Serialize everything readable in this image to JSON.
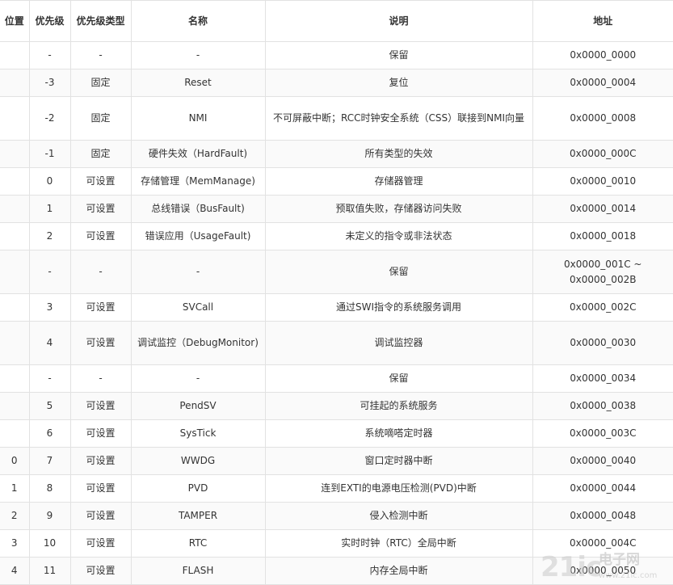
{
  "table": {
    "headers": [
      "位置",
      "优先级",
      "优先级类型",
      "名称",
      "说明",
      "地址"
    ],
    "rows": [
      {
        "pos": "",
        "priority": "-",
        "type": "-",
        "name": "-",
        "desc": "保留",
        "addr": "0x0000_0000"
      },
      {
        "pos": "",
        "priority": "-3",
        "type": "固定",
        "name": "Reset",
        "desc": "复位",
        "addr": "0x0000_0004"
      },
      {
        "pos": "",
        "priority": "-2",
        "type": "固定",
        "name": "NMI",
        "desc": "不可屏蔽中断；RCC时钟安全系统（CSS）联接到NMI向量",
        "addr": "0x0000_0008"
      },
      {
        "pos": "",
        "priority": "-1",
        "type": "固定",
        "name": "硬件失效（HardFault)",
        "desc": "所有类型的失效",
        "addr": "0x0000_000C"
      },
      {
        "pos": "",
        "priority": "0",
        "type": "可设置",
        "name": "存储管理（MemManage)",
        "desc": "存储器管理",
        "addr": "0x0000_0010"
      },
      {
        "pos": "",
        "priority": "1",
        "type": "可设置",
        "name": "总线错误（BusFault)",
        "desc": "预取值失败，存储器访问失败",
        "addr": "0x0000_0014"
      },
      {
        "pos": "",
        "priority": "2",
        "type": "可设置",
        "name": "错误应用（UsageFault)",
        "desc": "未定义的指令或非法状态",
        "addr": "0x0000_0018"
      },
      {
        "pos": "",
        "priority": "-",
        "type": "-",
        "name": "-",
        "desc": "保留",
        "addr": "0x0000_001C ~ 0x0000_002B"
      },
      {
        "pos": "",
        "priority": "3",
        "type": "可设置",
        "name": "SVCall",
        "desc": "通过SWI指令的系统服务调用",
        "addr": "0x0000_002C"
      },
      {
        "pos": "",
        "priority": "4",
        "type": "可设置",
        "name": "调试监控（DebugMonitor)",
        "desc": "调试监控器",
        "addr": "0x0000_0030"
      },
      {
        "pos": "",
        "priority": "-",
        "type": "-",
        "name": "-",
        "desc": "保留",
        "addr": "0x0000_0034"
      },
      {
        "pos": "",
        "priority": "5",
        "type": "可设置",
        "name": "PendSV",
        "desc": "可挂起的系统服务",
        "addr": "0x0000_0038"
      },
      {
        "pos": "",
        "priority": "6",
        "type": "可设置",
        "name": "SysTick",
        "desc": "系统嘀嗒定时器",
        "addr": "0x0000_003C"
      },
      {
        "pos": "0",
        "priority": "7",
        "type": "可设置",
        "name": "WWDG",
        "desc": "窗口定时器中断",
        "addr": "0x0000_0040"
      },
      {
        "pos": "1",
        "priority": "8",
        "type": "可设置",
        "name": "PVD",
        "desc": "连到EXTI的电源电压检测(PVD)中断",
        "addr": "0x0000_0044"
      },
      {
        "pos": "2",
        "priority": "9",
        "type": "可设置",
        "name": "TAMPER",
        "desc": "侵入检测中断",
        "addr": "0x0000_0048"
      },
      {
        "pos": "3",
        "priority": "10",
        "type": "可设置",
        "name": "RTC",
        "desc": "实时时钟（RTC）全局中断",
        "addr": "0x0000_004C"
      },
      {
        "pos": "4",
        "priority": "11",
        "type": "可设置",
        "name": "FLASH",
        "desc": "内存全局中断",
        "addr": "0x0000_0050"
      }
    ]
  },
  "watermark": {
    "big": "21ic",
    "cn": "电子网",
    "url": "www.21ic.com"
  }
}
